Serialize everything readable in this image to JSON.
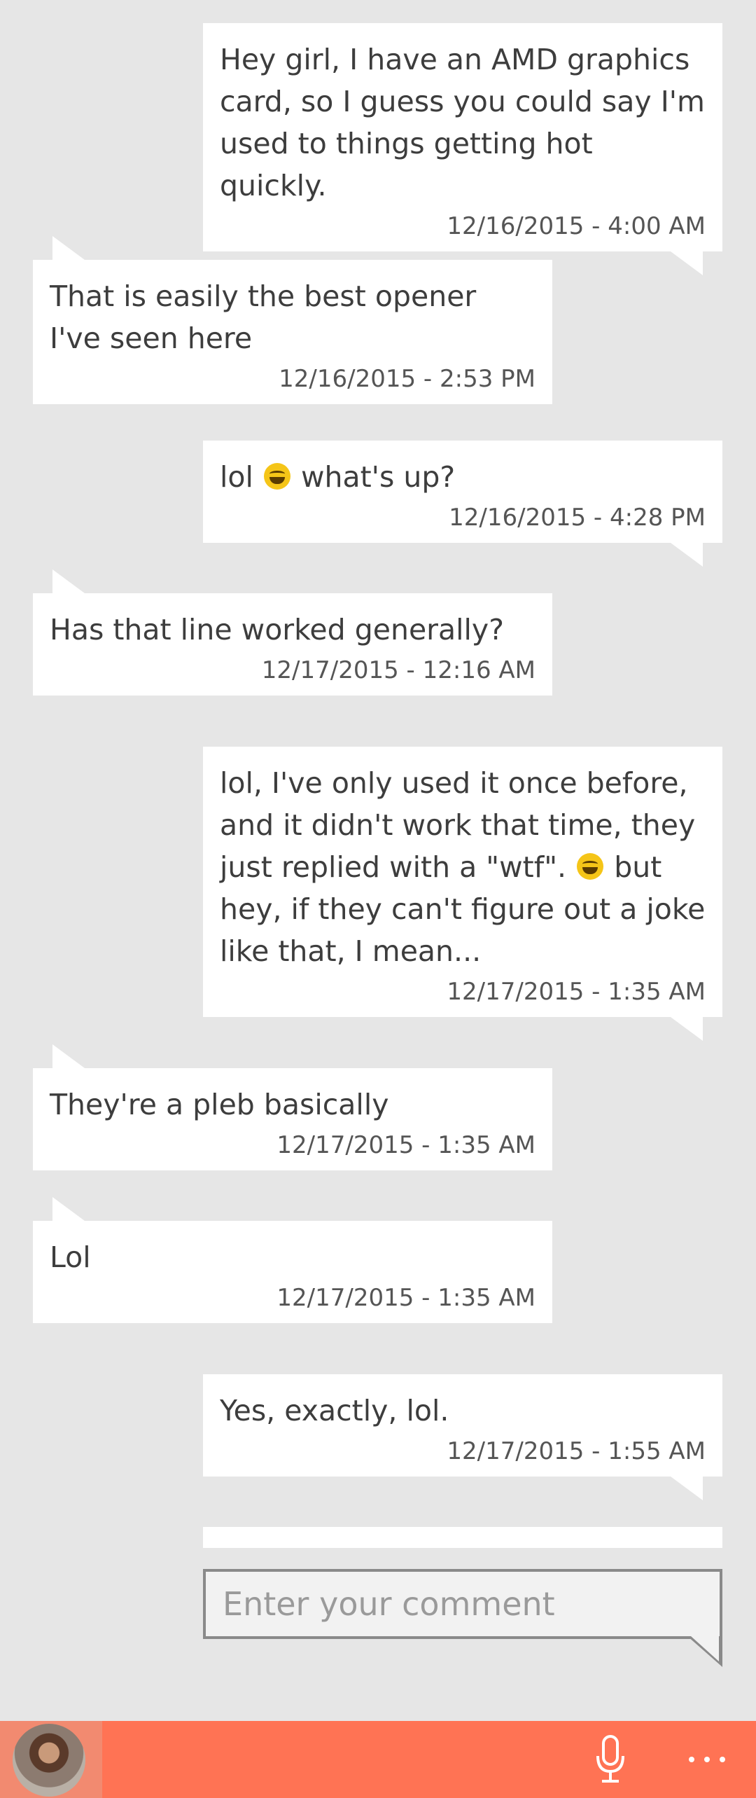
{
  "messages": [
    {
      "side": "sent",
      "text": "Hey girl, I have an AMD graphics card, so I guess you could say I'm used to things getting hot quickly.",
      "time": "12/16/2015 - 4:00 AM"
    },
    {
      "side": "recv",
      "text": "That is easily the best opener I've seen here",
      "time": "12/16/2015 - 2:53 PM"
    },
    {
      "side": "sent",
      "text_before": "lol",
      "emoji": "laughing-emoji",
      "text_after": "what's up?",
      "time": "12/16/2015 - 4:28 PM"
    },
    {
      "side": "recv",
      "text": "Has that line worked generally?",
      "time": "12/17/2015 - 12:16 AM"
    },
    {
      "side": "sent",
      "text_before": "lol, I've only used it once before, and it didn't work that time, they just replied with a \"wtf\".",
      "emoji": "laughing-emoji",
      "text_after": "but hey, if they can't figure out a joke like that, I mean...",
      "time": "12/17/2015 - 1:35 AM"
    },
    {
      "side": "recv",
      "text": "They're a pleb basically",
      "time": "12/17/2015 - 1:35 AM"
    },
    {
      "side": "recv",
      "text": "Lol",
      "time": "12/17/2015 - 1:35 AM"
    },
    {
      "side": "sent",
      "text": "Yes, exactly, lol.",
      "time": "12/17/2015 - 1:55 AM"
    }
  ],
  "composer": {
    "placeholder": "Enter your comment"
  },
  "appbar": {
    "color": "#ff7354",
    "icons": [
      "avatar",
      "microphone-icon",
      "more-icon"
    ]
  }
}
